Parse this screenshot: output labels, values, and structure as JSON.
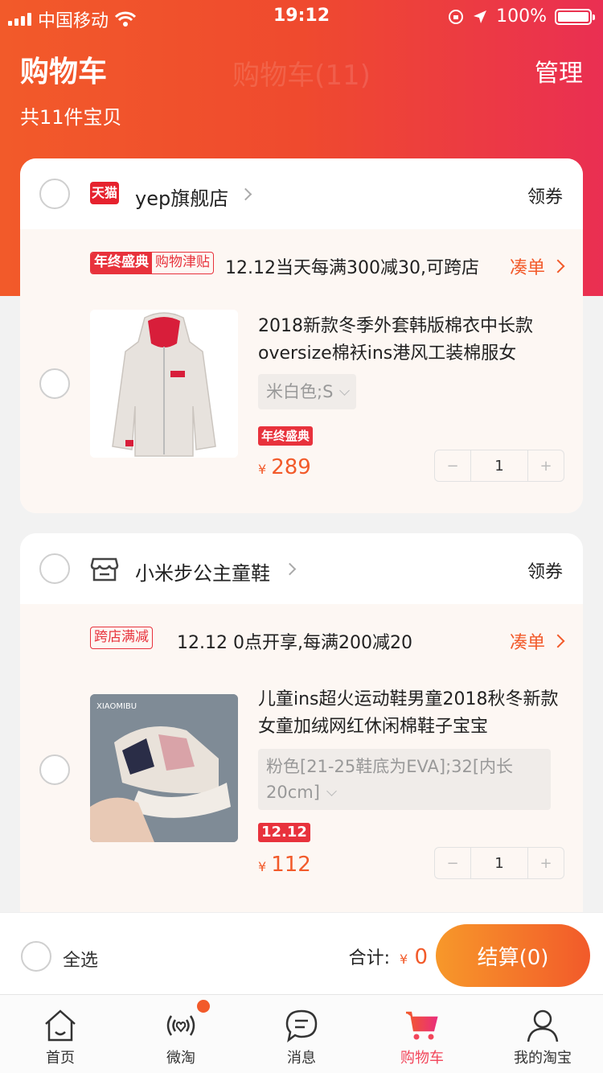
{
  "status_bar": {
    "carrier": "中国移动",
    "time": "19:12",
    "battery": "100%"
  },
  "header": {
    "title": "购物车",
    "center_title": "购物车(11)",
    "manage_label": "管理",
    "count_text": "共11件宝贝"
  },
  "shops": [
    {
      "name": "yep旗舰店",
      "logo": "天猫",
      "coupon_label": "领券",
      "promo": {
        "tag_a": "年终盛典",
        "tag_b": "购物津贴",
        "text": "12.12当天每满300减30,可跨店",
        "action": "凑单"
      },
      "item": {
        "title": "2018新款冬季外套韩版棉衣中长款oversize棉袄ins港风工装棉服女",
        "sku": "米白色;S",
        "badge": "年终盛典",
        "currency": "¥",
        "price": "289",
        "qty": "1"
      }
    },
    {
      "name": "小米步公主童鞋",
      "coupon_label": "领券",
      "promo": {
        "tag_a": "",
        "tag_b": "跨店满减",
        "text": "12.12 0点开享,每满200减20",
        "action": "凑单"
      },
      "item": {
        "title": "儿童ins超火运动鞋男童2018秋冬新款女童加绒网红休闲棉鞋子宝宝",
        "sku": "粉色[21-25鞋底为EVA];32[内长20cm]",
        "badge": "12.12",
        "image_text": "XIAOMIBU",
        "currency": "¥",
        "price": "112",
        "qty": "1"
      }
    }
  ],
  "stepper": {
    "minus": "−",
    "plus": "+"
  },
  "bottom": {
    "select_all": "全选",
    "total_label": "合计:",
    "currency": "¥",
    "total": "0",
    "checkout": "结算(0)"
  },
  "tabs": [
    {
      "label": "首页",
      "icon": "home-icon"
    },
    {
      "label": "微淘",
      "icon": "weitao-icon"
    },
    {
      "label": "消息",
      "icon": "message-icon"
    },
    {
      "label": "购物车",
      "icon": "cart-icon"
    },
    {
      "label": "我的淘宝",
      "icon": "profile-icon"
    }
  ],
  "colors": {
    "accent": "#f25a2a",
    "red": "#e8323c",
    "header_start": "#f25a2a",
    "header_end": "#ea2f52"
  }
}
